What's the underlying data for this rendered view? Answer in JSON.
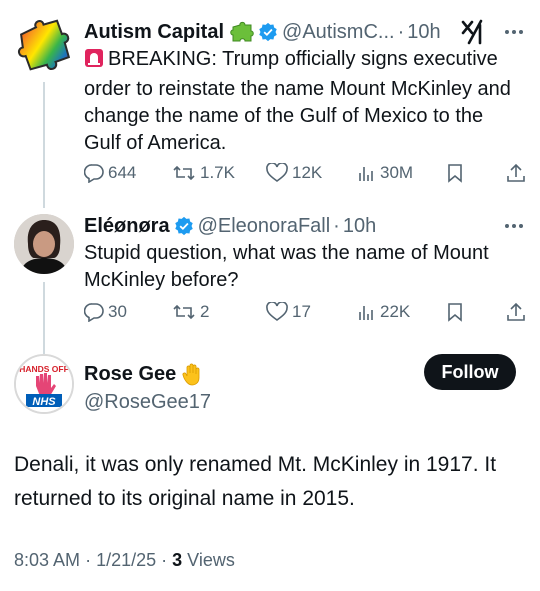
{
  "tweet1": {
    "name": "Autism Capital",
    "handle": "@AutismC...",
    "time": "10h",
    "text": "BREAKING: Trump officially signs executive order to reinstate the name Mount McKinley and change the name of the Gulf of Mexico to the Gulf of America.",
    "replies": "644",
    "retweets": "1.7K",
    "likes": "12K",
    "views": "30M"
  },
  "tweet2": {
    "name": "Eléønøra",
    "handle": "@EleonoraFall",
    "time": "10h",
    "text": "Stupid question, what was the name of Mount McKinley before?",
    "replies": "30",
    "retweets": "2",
    "likes": "17",
    "views": "22K"
  },
  "main": {
    "name": "Rose Gee",
    "handle": "@RoseGee17",
    "follow_label": "Follow",
    "text": "Denali, it was only renamed Mt. McKinley in 1917. It returned to its original name in 2015.",
    "time": "8:03 AM",
    "date": "1/21/25",
    "views_count": "3",
    "views_label": "Views",
    "avatar_text_top": "HANDS OFF",
    "avatar_text_bottom": "NHS"
  },
  "colors": {
    "verified": "#1d9bf0",
    "secondary": "#536471",
    "line": "#cfd9de"
  }
}
